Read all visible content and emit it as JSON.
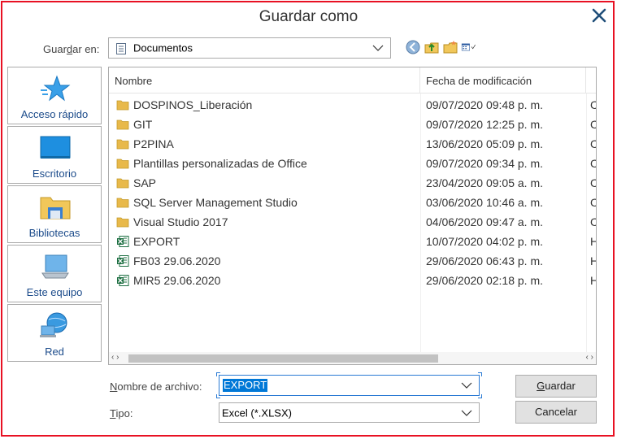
{
  "dialog": {
    "title": "Guardar como",
    "close_icon": "close-icon"
  },
  "save_in": {
    "label_pre": "Guar",
    "label_u": "d",
    "label_post": "ar en:",
    "value": "Documentos"
  },
  "places": [
    {
      "label": "Acceso rápido",
      "icon": "quick-access-star-icon"
    },
    {
      "label": "Escritorio",
      "icon": "desktop-icon"
    },
    {
      "label": "Bibliotecas",
      "icon": "libraries-icon"
    },
    {
      "label": "Este equipo",
      "icon": "computer-icon"
    },
    {
      "label": "Red",
      "icon": "network-icon"
    }
  ],
  "columns": {
    "name": "Nombre",
    "date": "Fecha de modificación"
  },
  "files": [
    {
      "name": "DOSPINOS_Liberación",
      "date": "09/07/2020 09:48 p. m.",
      "type": "C",
      "icon": "folder-icon"
    },
    {
      "name": "GIT",
      "date": "09/07/2020 12:25 p. m.",
      "type": "C",
      "icon": "folder-icon"
    },
    {
      "name": "P2PINA",
      "date": "13/06/2020 05:09 p. m.",
      "type": "C",
      "icon": "folder-icon"
    },
    {
      "name": "Plantillas personalizadas de Office",
      "date": "09/07/2020 09:34 p. m.",
      "type": "C",
      "icon": "folder-icon"
    },
    {
      "name": "SAP",
      "date": "23/04/2020 09:05 a. m.",
      "type": "C",
      "icon": "folder-icon"
    },
    {
      "name": "SQL Server Management Studio",
      "date": "03/06/2020 10:46 a. m.",
      "type": "C",
      "icon": "folder-icon"
    },
    {
      "name": "Visual Studio 2017",
      "date": "04/06/2020 09:47 a. m.",
      "type": "C",
      "icon": "folder-icon"
    },
    {
      "name": "EXPORT",
      "date": "10/07/2020 04:02 p. m.",
      "type": "H",
      "icon": "excel-file-icon"
    },
    {
      "name": "FB03 29.06.2020",
      "date": "29/06/2020 06:43 p. m.",
      "type": "H",
      "icon": "excel-file-icon"
    },
    {
      "name": "MIR5 29.06.2020",
      "date": "29/06/2020 02:18 p. m.",
      "type": "H",
      "icon": "excel-file-icon"
    }
  ],
  "filename": {
    "label_u": "N",
    "label_post": "ombre de archivo:",
    "value": "EXPORT"
  },
  "filetype": {
    "label_u": "T",
    "label_post": "ipo:",
    "value": "Excel (*.XLSX)"
  },
  "buttons": {
    "save_u": "G",
    "save_post": "uardar",
    "cancel": "Cancelar"
  },
  "colors": {
    "frame": "#e81123",
    "selection": "#0078d7",
    "folder": "#e8b94a",
    "excel": "#1d6f42",
    "place_label": "#1a4a8a"
  }
}
